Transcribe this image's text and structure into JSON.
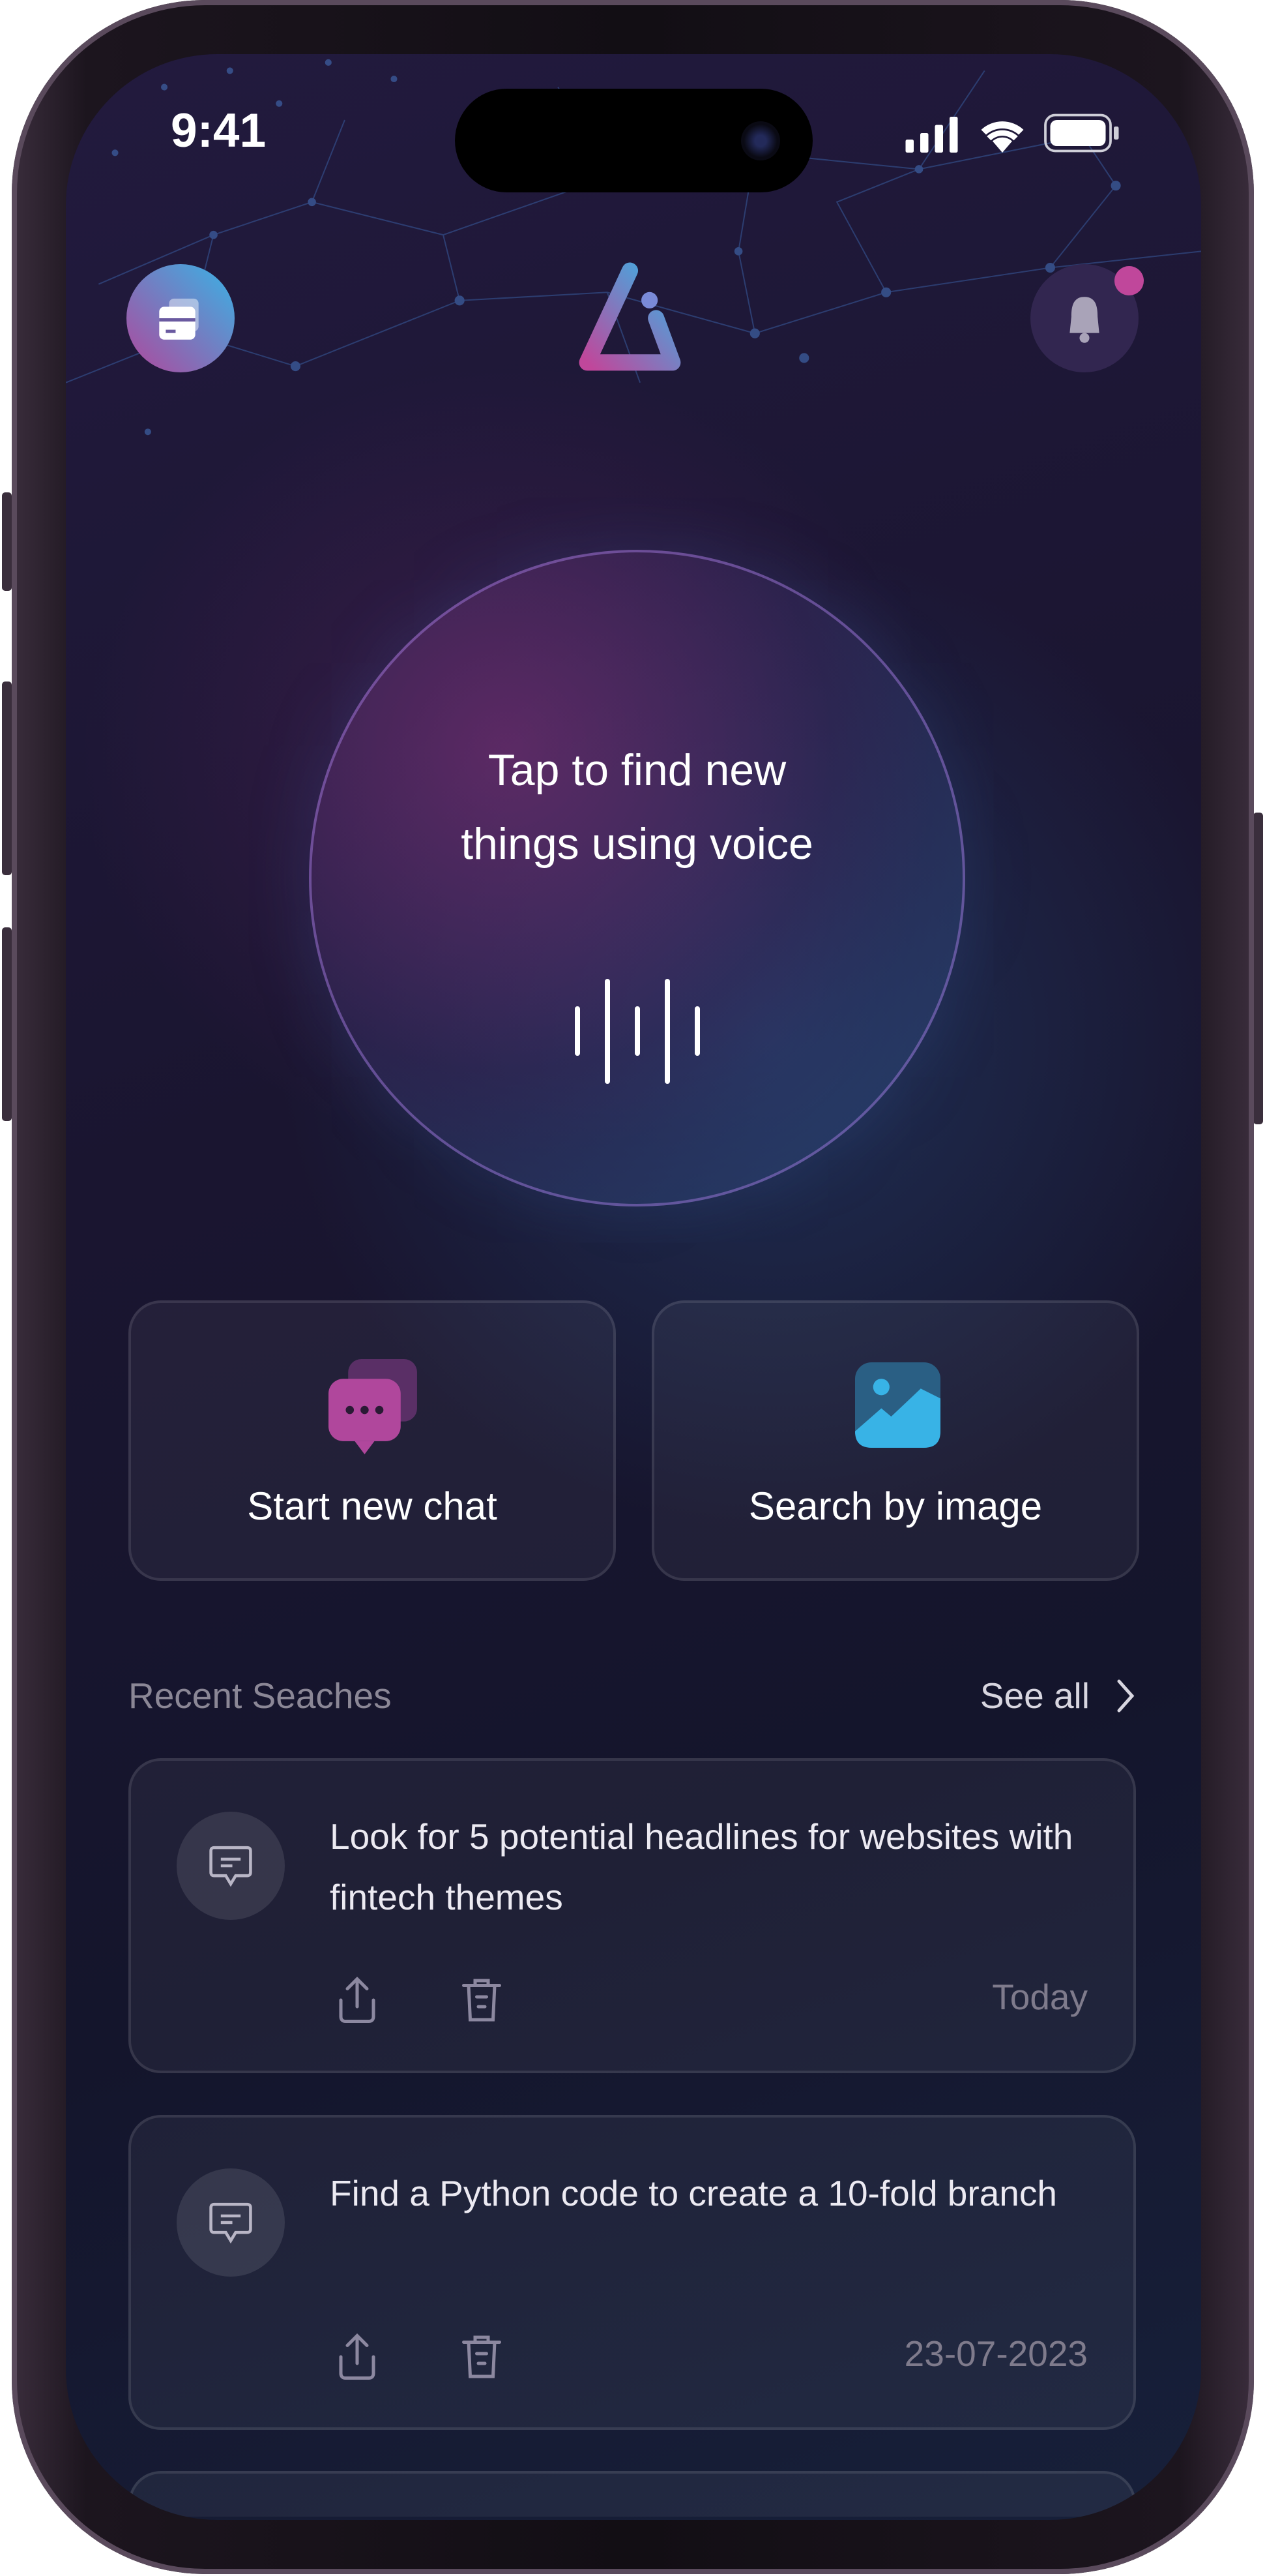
{
  "status_bar": {
    "time": "9:41"
  },
  "header": {
    "left_icon": "card-icon",
    "logo": "app-logo",
    "right_icon": "bell-icon",
    "notification_dot_color": "#c0479b"
  },
  "voice": {
    "prompt": "Tap to find new things using voice"
  },
  "actions": [
    {
      "label": "Start new chat",
      "icon": "chat-bubbles-icon",
      "color": "#b0479c"
    },
    {
      "label": "Search by image",
      "icon": "image-icon",
      "color": "#38b3e6"
    }
  ],
  "recent": {
    "title": "Recent Seaches",
    "see_all": "See all",
    "items": [
      {
        "query": "Look for 5 potential headlines for websites with fintech themes",
        "date": "Today"
      },
      {
        "query": "Find a Python code to create a 10-fold branch",
        "date": "23-07-2023"
      }
    ]
  }
}
